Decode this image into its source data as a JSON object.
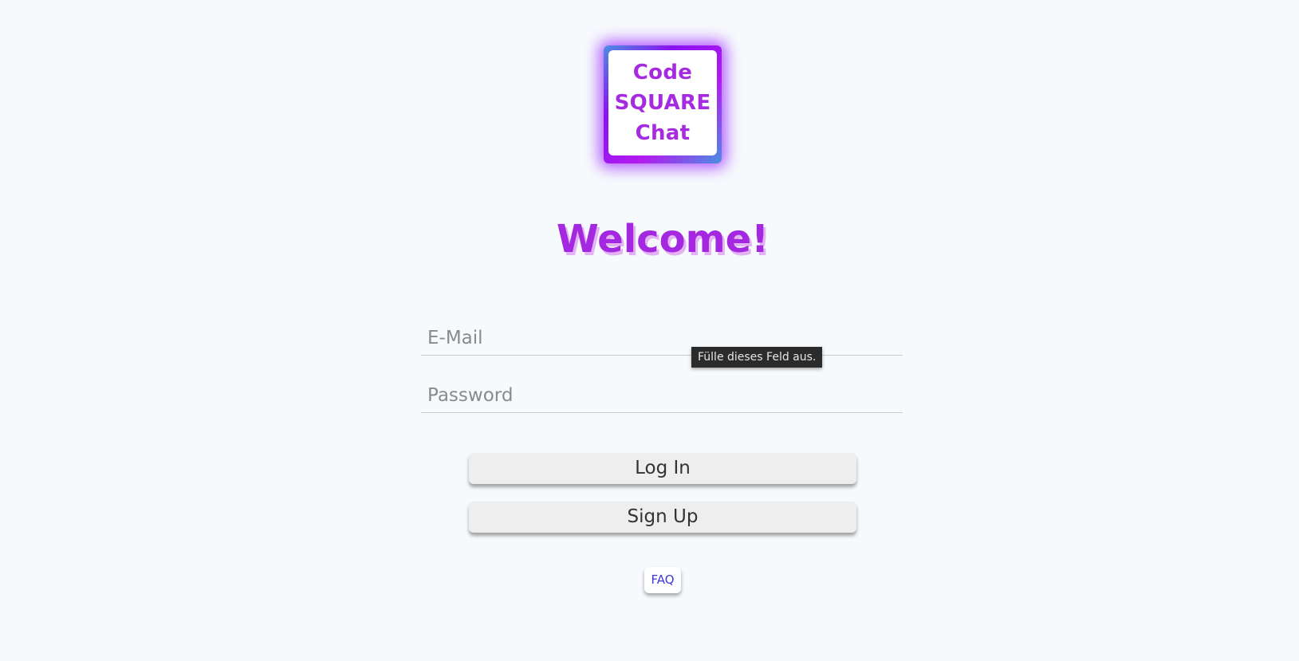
{
  "logo": {
    "lines": [
      "Code",
      "SQUARE",
      "Chat"
    ],
    "text_color": "#a52ae0",
    "glow_color": "#9b28ff"
  },
  "heading": {
    "text": "Welcome!",
    "color": "#a428e0"
  },
  "form": {
    "email_placeholder": "E-Mail",
    "email_value": "",
    "password_placeholder": "Password",
    "password_value": "",
    "validation_tooltip": "Fülle dieses Feld aus."
  },
  "buttons": {
    "login_label": "Log In",
    "signup_label": "Sign Up"
  },
  "links": {
    "faq_label": "FAQ",
    "faq_color": "#3b3bdc"
  }
}
